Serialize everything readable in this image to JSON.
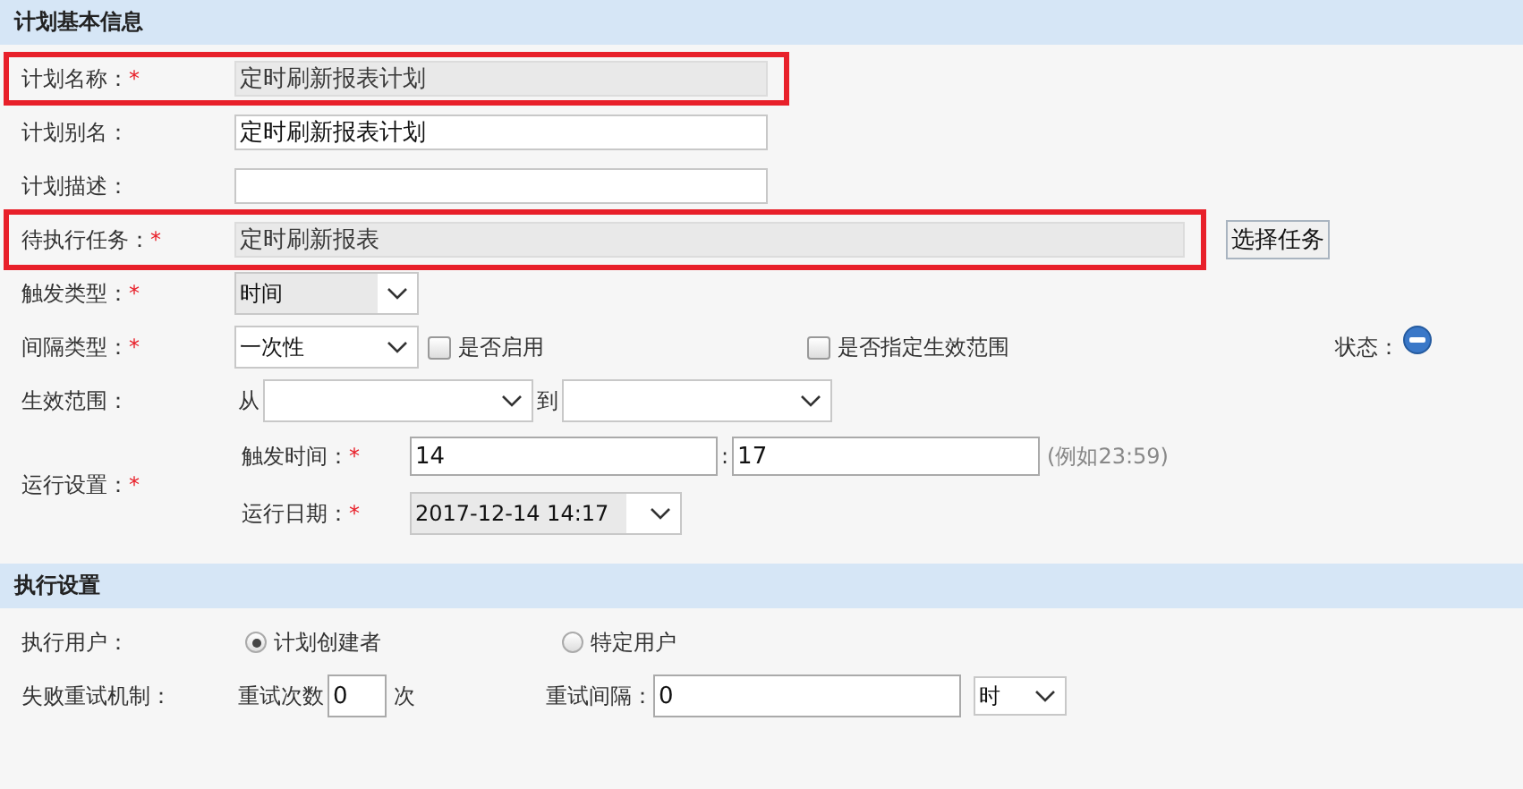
{
  "sections": [
    {
      "title": "计划基本信息",
      "rows": [
        {
          "kind": "input",
          "label": "计划名称：",
          "required_mark": "*",
          "value": "定时刷新报表计划",
          "readonly": true,
          "highlighted": true,
          "wide": false
        },
        {
          "kind": "input",
          "label": "计划别名：",
          "value": "定时刷新报表计划",
          "readonly": false,
          "highlighted": false,
          "wide": false
        },
        {
          "kind": "input",
          "label": "计划描述：",
          "readonly": false,
          "highlighted": false,
          "wide": false
        },
        {
          "kind": "input",
          "label": "待执行任务：",
          "required_mark": "*",
          "value": "定时刷新报表",
          "readonly": true,
          "highlighted": true,
          "wide": true,
          "button": "选择任务"
        },
        {
          "kind": "select",
          "label": "触发类型：",
          "required_mark": "*",
          "value": "时间",
          "disabled": true
        },
        {
          "kind": "interval",
          "label": "间隔类型：",
          "required_mark": "*",
          "value": "一次性",
          "checks": [
            {
              "label": "是否启用",
              "checked": false
            },
            {
              "label": "是否指定生效范围",
              "checked": false
            }
          ],
          "status_label": "状态："
        },
        {
          "kind": "range",
          "label": "生效范围：",
          "from": "从",
          "to": "到"
        },
        {
          "kind": "run",
          "label": "运行设置：",
          "required_mark": "*",
          "time": {
            "label": "触发时间：",
            "required_mark": "*",
            "hour": "14",
            "separator": ":",
            "minute": "17",
            "hint": "(例如23:59)"
          },
          "date": {
            "label": "运行日期：",
            "required_mark": "*",
            "value": "2017-12-14 14:17"
          }
        }
      ]
    },
    {
      "title": "执行设置",
      "rows": [
        {
          "kind": "radio",
          "label": "执行用户：",
          "options": [
            {
              "label": "计划创建者",
              "selected": true
            },
            {
              "label": "特定用户",
              "selected": false
            }
          ]
        },
        {
          "kind": "retry",
          "label": "失败重试机制：",
          "count_label": "重试次数",
          "count": "0",
          "count_unit": "次",
          "interval_label": "重试间隔：",
          "interval": "0",
          "unit": "时"
        }
      ]
    }
  ]
}
